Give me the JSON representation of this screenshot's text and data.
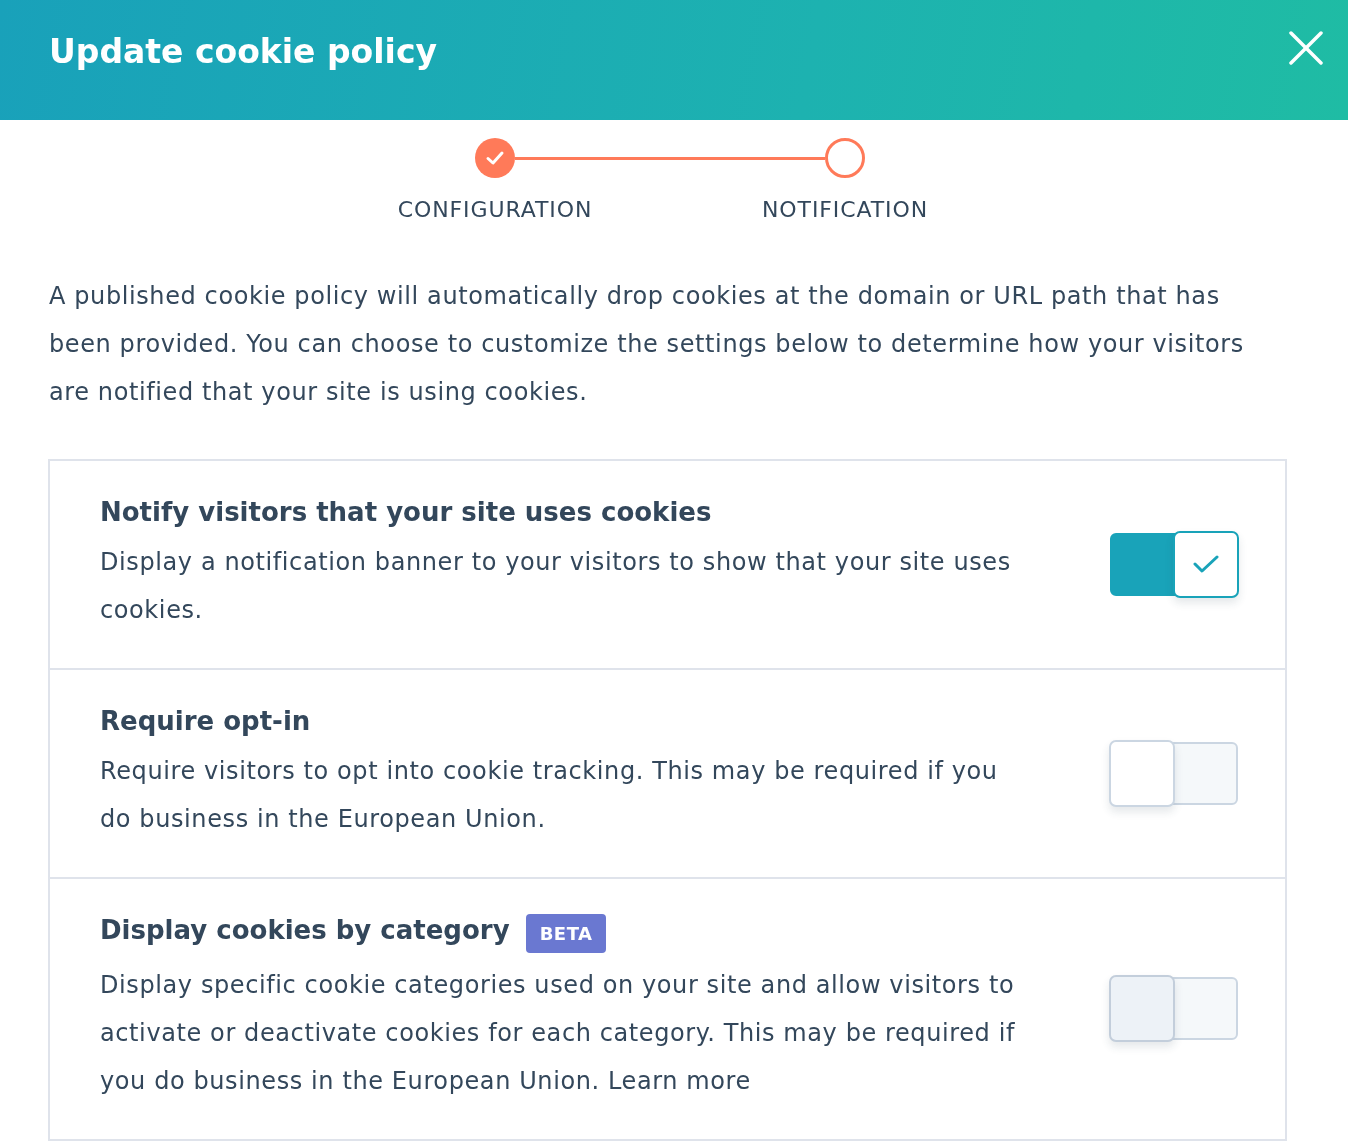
{
  "dialog": {
    "title": "Update cookie policy"
  },
  "steps": [
    {
      "label": "CONFIGURATION",
      "completed": true
    },
    {
      "label": "NOTIFICATION",
      "completed": false
    }
  ],
  "intro": "A published cookie policy will automatically drop cookies at the domain or URL path that has been provided. You can choose to customize the settings below to determine how your visitors are notified that your site is using cookies.",
  "settings": [
    {
      "title": "Notify visitors that your site uses cookies",
      "description": "Display a notification banner to your visitors to show that your site uses cookies.",
      "on": true,
      "disabled": false
    },
    {
      "title": "Require opt-in",
      "description": "Require visitors to opt into cookie tracking. This may be required if you do business in the European Union.",
      "on": false,
      "disabled": false
    },
    {
      "title": "Display cookies by category",
      "badge": "BETA",
      "description": "Display specific cookie categories used on your site and allow visitors to activate or deactivate cookies for each category. This may be required if you do business in the European Union. Learn more",
      "on": false,
      "disabled": true
    }
  ]
}
